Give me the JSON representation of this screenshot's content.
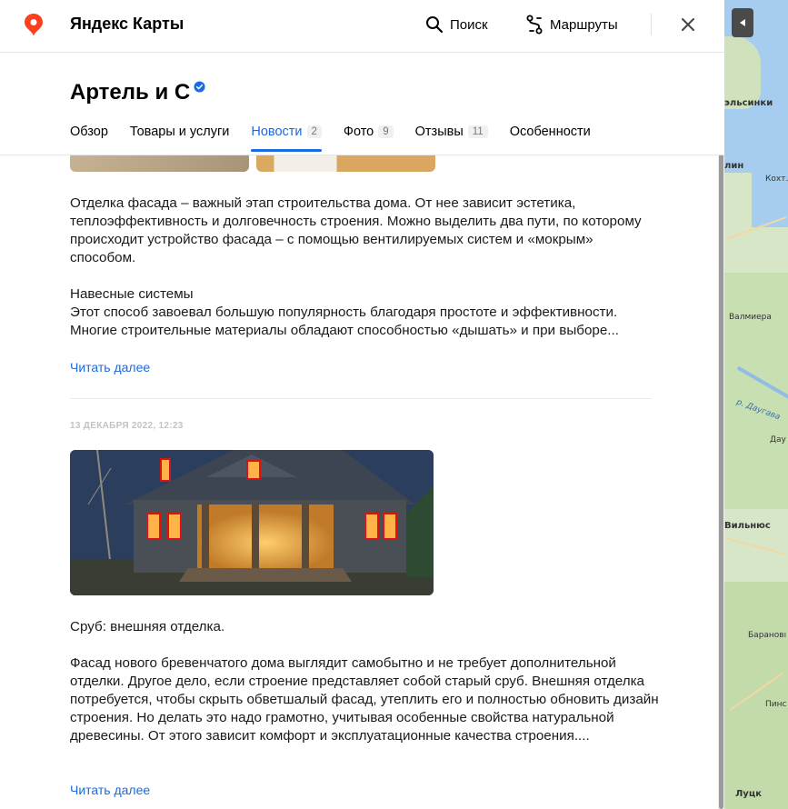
{
  "app": {
    "title": "Яндекс Карты"
  },
  "topbar": {
    "search_label": "Поиск",
    "routes_label": "Маршруты"
  },
  "org": {
    "name": "Артель и С"
  },
  "tabs": [
    {
      "label": "Обзор",
      "count": null
    },
    {
      "label": "Товары и услуги",
      "count": null
    },
    {
      "label": "Новости",
      "count": "2",
      "active": true
    },
    {
      "label": "Фото",
      "count": "9"
    },
    {
      "label": "Отзывы",
      "count": "11"
    },
    {
      "label": "Особенности",
      "count": null
    }
  ],
  "posts": [
    {
      "paragraphs": [
        "Отделка фасада – важный этап строительства дома. От нее зависит эстетика, теплоэффективность и долговечность строения. Можно выделить два пути, по которому происходит устройство фасада – с помощью вентилируемых систем и «мокрым» способом.",
        "Навесные системы",
        "Этот способ завоевал большую популярность благодаря простоте и эффективности. Многие строительные материалы обладают способностью «дышать» и при выборе..."
      ],
      "read_more": "Читать далее"
    },
    {
      "date": "13 ДЕКАБРЯ 2022, 12:23",
      "paragraphs": [
        "Сруб: внешняя отделка.",
        "Фасад нового бревенчатого дома выглядит самобытно и не требует дополнительной отделки. Другое дело, если строение представляет собой старый сруб. Внешняя отделка потребуется, чтобы скрыть обветшалый фасад, утеплить его и полностью обновить дизайн строения. Но делать это надо грамотно, учитывая особенные свойства натуральной древесины. От этого зависит комфорт и эксплуатационные качества строения...."
      ],
      "read_more": "Читать далее"
    }
  ],
  "map": {
    "labels": [
      "эльсинки",
      "лин",
      "Кохт...",
      "Валмиера",
      "р. Даугава",
      "Дау",
      "Вильнюс",
      "Барановı",
      "Пинс",
      "Луцк"
    ]
  },
  "colors": {
    "accent": "#1a6ae0",
    "logo": "#fc3f1d"
  }
}
